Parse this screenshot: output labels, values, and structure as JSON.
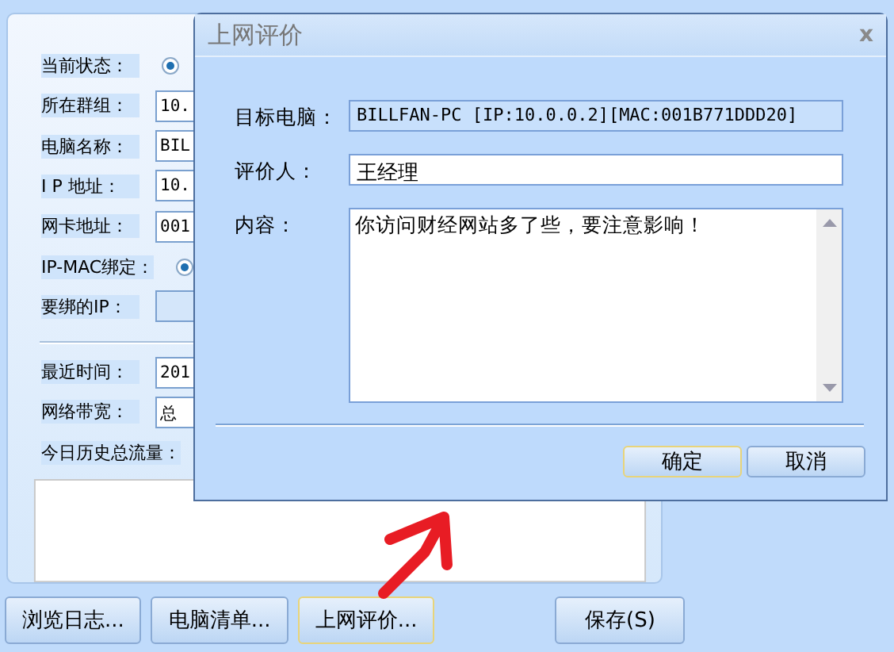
{
  "main": {
    "fields": [
      {
        "kind": "radio",
        "label": "当前状态：",
        "selected": true
      },
      {
        "kind": "text",
        "label": "所在群组：",
        "value": "10."
      },
      {
        "kind": "text",
        "label": "电脑名称：",
        "value": "BIL"
      },
      {
        "kind": "text",
        "label": "I P 地址：",
        "value": "10."
      },
      {
        "kind": "text",
        "label": "网卡地址：",
        "value": "001"
      },
      {
        "kind": "radio",
        "label": "IP-MAC绑定：",
        "selected": true
      },
      {
        "kind": "disabled",
        "label": "要绑的IP："
      },
      {
        "kind": "divider"
      },
      {
        "kind": "text",
        "label": "最近时间：",
        "value": "201"
      },
      {
        "kind": "text",
        "label": "网络带宽：",
        "value": "总"
      }
    ],
    "history_label": "今日历史总流量："
  },
  "buttons": [
    {
      "label": "浏览日志...",
      "focused": false
    },
    {
      "label": "电脑清单...",
      "focused": false
    },
    {
      "label": "上网评价...",
      "focused": true
    },
    {
      "kind": "gap"
    },
    {
      "label": "保存(S)",
      "focused": false
    }
  ],
  "dialog": {
    "title": "上网评价",
    "close": "x",
    "target": {
      "label": "目标电脑：",
      "value": "BILLFAN-PC [IP:10.0.0.2][MAC:001B771DDD20]"
    },
    "reviewer": {
      "label": "评价人：",
      "value": "王经理"
    },
    "content": {
      "label": "内容：",
      "value": "你访问财经网站多了些，要注意影响！"
    },
    "buttons": [
      {
        "label": "确定",
        "focused": true
      },
      {
        "label": "取消",
        "focused": false
      }
    ]
  }
}
